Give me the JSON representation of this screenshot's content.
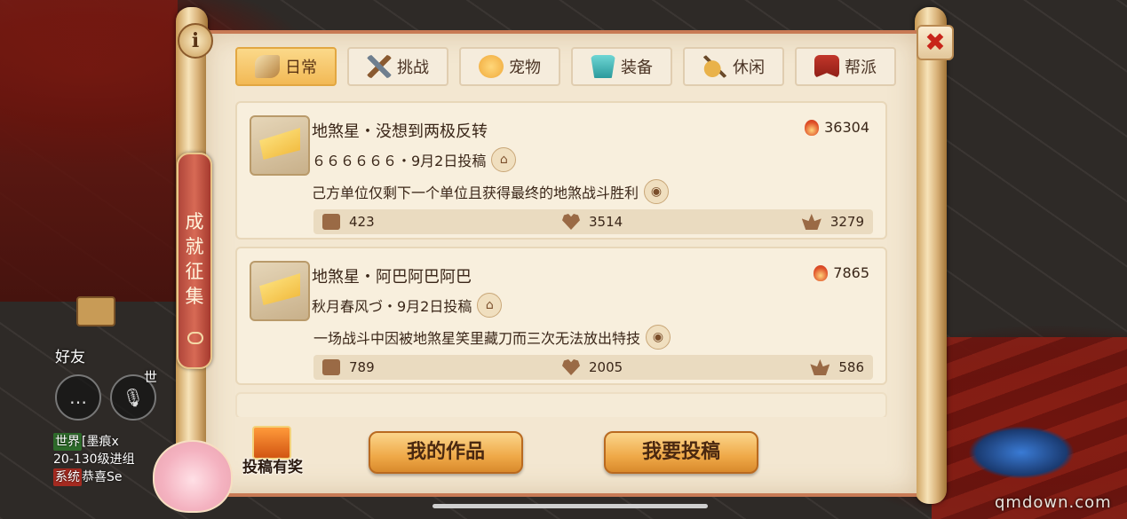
{
  "window": {
    "info_label": "i",
    "close_label": "✖",
    "side_tab_label": "成就征集"
  },
  "tabs": [
    {
      "label": "日常",
      "icon": "horn-icon",
      "active": true
    },
    {
      "label": "挑战",
      "icon": "crossed-swords-icon",
      "active": false
    },
    {
      "label": "宠物",
      "icon": "pet-face-icon",
      "active": false
    },
    {
      "label": "装备",
      "icon": "armor-icon",
      "active": false
    },
    {
      "label": "休闲",
      "icon": "lute-icon",
      "active": false
    },
    {
      "label": "帮派",
      "icon": "banner-icon",
      "active": false
    }
  ],
  "entries": [
    {
      "title": "地煞星・没想到两极反转",
      "heat": "36304",
      "author_line": "６６６６６６・9月2日投稿",
      "description": "己方单位仅剩下一个单位且获得最终的地煞战斗胜利",
      "shares": "423",
      "likes": "3514",
      "flowers": "3279"
    },
    {
      "title": "地煞星・阿巴阿巴阿巴",
      "heat": "7865",
      "author_line": "秋月春风づ・9月2日投稿",
      "description": "一场战斗中因被地煞星笑里藏刀而三次无法放出特技",
      "shares": "789",
      "likes": "2005",
      "flowers": "586"
    }
  ],
  "buttons": {
    "my_works": "我的作品",
    "submit": "我要投稿",
    "reward": "投稿有奖"
  },
  "hud": {
    "friends_label": "好友",
    "voice_channel": "世",
    "chat_lines": [
      {
        "tag": "世界",
        "text": "[墨痕x"
      },
      {
        "tag": "",
        "text": "20-130级进组"
      },
      {
        "tag": "系统",
        "text": "恭喜Se"
      }
    ]
  },
  "watermark": "qmdown.com",
  "colors": {
    "active_tab": "#f2b955",
    "panel": "#f3e7d1",
    "close_red": "#c8241a",
    "side_tab": "#b0463a"
  }
}
